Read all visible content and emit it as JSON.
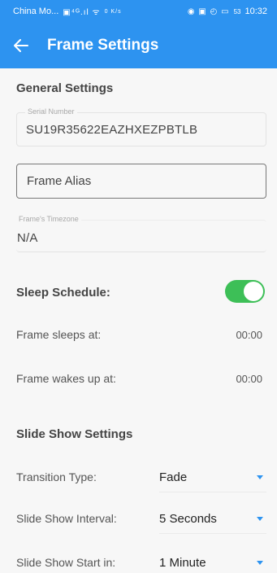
{
  "status_bar": {
    "carrier": "China Mo...",
    "signal_glyphs": "▣⁴ᴳ.ıl ᯤ",
    "speed": "0 K/s",
    "right_glyphs": "◉ ▣ ◴ ▭",
    "battery": "53",
    "time": "10:32"
  },
  "app_bar": {
    "back_icon": "arrow-left",
    "title": "Frame Settings"
  },
  "general": {
    "title": "General Settings",
    "serial": {
      "label": "Serial Number",
      "value": "SU19R35622EAZHXEZPBTLB"
    },
    "alias": {
      "placeholder": "Frame Alias"
    },
    "timezone": {
      "label": "Frame's Timezone",
      "value": "N/A"
    }
  },
  "sleep": {
    "title": "Sleep Schedule:",
    "enabled": true,
    "toggle_color": "#3dbf57",
    "sleeps_label": "Frame sleeps at:",
    "sleeps_value": "00:00",
    "wakes_label": "Frame wakes up at:",
    "wakes_value": "00:00"
  },
  "slideshow": {
    "title": "Slide Show Settings",
    "transition_label": "Transition Type:",
    "transition_value": "Fade",
    "interval_label": "Slide Show Interval:",
    "interval_value": "5 Seconds",
    "start_label": "Slide Show Start in:",
    "start_value": "1 Minute"
  },
  "colors": {
    "accent": "#2d93f0"
  }
}
